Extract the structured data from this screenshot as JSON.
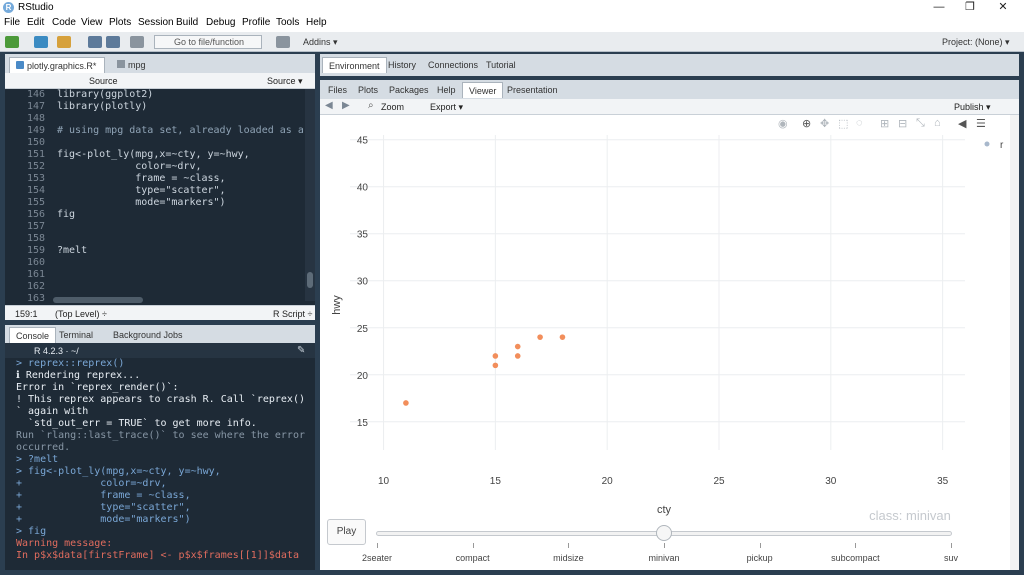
{
  "window": {
    "title": "RStudio",
    "minimize": "—",
    "restore": "❐",
    "close": "✕"
  },
  "menu": [
    "File",
    "Edit",
    "Code",
    "View",
    "Plots",
    "Session",
    "Build",
    "Debug",
    "Profile",
    "Tools",
    "Help"
  ],
  "toolbar": {
    "goto_placeholder": "Go to file/function",
    "addins": "Addins ▾",
    "project": "Project: (None) ▾"
  },
  "editor": {
    "tabs": [
      {
        "label": "plotly.graphics.R*"
      },
      {
        "label": "mpg"
      }
    ],
    "source_label": "Source",
    "source_menu": "Source ▾",
    "lines": [
      {
        "n": "146",
        "text": "library(ggplot2)",
        "style": "code"
      },
      {
        "n": "147",
        "text": "library(plotly)",
        "style": "code"
      },
      {
        "n": "148",
        "text": "",
        "style": "code"
      },
      {
        "n": "149",
        "text": "# using mpg data set, already loaded as a",
        "style": "comment"
      },
      {
        "n": "150",
        "text": "",
        "style": "code"
      },
      {
        "n": "151",
        "text": "fig<-plot_ly(mpg,x=~cty, y=~hwy,",
        "style": "code"
      },
      {
        "n": "152",
        "text": "             color=~drv,",
        "style": "code"
      },
      {
        "n": "153",
        "text": "             frame = ~class,",
        "style": "code"
      },
      {
        "n": "154",
        "text": "             type=\"scatter\",",
        "style": "code"
      },
      {
        "n": "155",
        "text": "             mode=\"markers\")",
        "style": "code"
      },
      {
        "n": "156",
        "text": "fig",
        "style": "code"
      },
      {
        "n": "157",
        "text": "",
        "style": "code"
      },
      {
        "n": "158",
        "text": "",
        "style": "code"
      },
      {
        "n": "159",
        "text": "?melt",
        "style": "code"
      },
      {
        "n": "160",
        "text": "",
        "style": "code"
      },
      {
        "n": "161",
        "text": "",
        "style": "code"
      },
      {
        "n": "162",
        "text": "",
        "style": "code"
      },
      {
        "n": "163",
        "text": "",
        "style": "code"
      }
    ],
    "status_pos": "159:1",
    "status_scope": "(Top Level) ÷",
    "status_type": "R Script ÷"
  },
  "console": {
    "tabs": [
      {
        "label": "Console"
      },
      {
        "label": "Terminal"
      },
      {
        "label": "Background Jobs"
      }
    ],
    "version": "R 4.2.3 · ~/",
    "lines": [
      {
        "text": "> reprex::reprex()",
        "style": "prompt"
      },
      {
        "text": "ℹ Rendering reprex...",
        "style": "white"
      },
      {
        "text": "Error in `reprex_render()`:",
        "style": "white"
      },
      {
        "text": "! This reprex appears to crash R. Call `reprex()",
        "style": "white"
      },
      {
        "text": "` again with",
        "style": "white"
      },
      {
        "text": "  `std_out_err = TRUE` to get more info.",
        "style": "white"
      },
      {
        "text": "Run `rlang::last_trace()` to see where the error",
        "style": "dim"
      },
      {
        "text": "occurred.",
        "style": "dim"
      },
      {
        "text": "> ?melt",
        "style": "prompt"
      },
      {
        "text": "> fig<-plot_ly(mpg,x=~cty, y=~hwy,",
        "style": "prompt"
      },
      {
        "text": "+             color=~drv,",
        "style": "prompt"
      },
      {
        "text": "+             frame = ~class,",
        "style": "prompt"
      },
      {
        "text": "+             type=\"scatter\",",
        "style": "prompt"
      },
      {
        "text": "+             mode=\"markers\")",
        "style": "prompt"
      },
      {
        "text": "> fig",
        "style": "prompt"
      },
      {
        "text": "Warning message:",
        "style": "err"
      },
      {
        "text": "In p$x$data[firstFrame] <- p$x$frames[[1]]$data",
        "style": "err"
      }
    ]
  },
  "env_panel": {
    "tabs": [
      {
        "label": "Environment"
      },
      {
        "label": "History"
      },
      {
        "label": "Connections"
      },
      {
        "label": "Tutorial"
      }
    ]
  },
  "viewer_panel": {
    "tabs": [
      {
        "label": "Files"
      },
      {
        "label": "Plots"
      },
      {
        "label": "Packages"
      },
      {
        "label": "Help"
      },
      {
        "label": "Viewer"
      },
      {
        "label": "Presentation"
      }
    ],
    "zoom": "Zoom",
    "export": "Export ▾",
    "publish": "Publish ▾"
  },
  "chart_data": {
    "type": "scatter",
    "xlabel": "cty",
    "ylabel": "hwy",
    "xlim": [
      8.5,
      36
    ],
    "ylim": [
      12,
      45.5
    ],
    "xticks": [
      10,
      15,
      20,
      25,
      30,
      35
    ],
    "yticks": [
      15,
      20,
      25,
      30,
      35,
      40,
      45
    ],
    "grid": true,
    "legend_position": "top-right",
    "series": [
      {
        "name": "r",
        "color": "#f28e5b",
        "points": [
          [
            11,
            17
          ],
          [
            15,
            21
          ],
          [
            15,
            22
          ],
          [
            16,
            22
          ],
          [
            16,
            23
          ],
          [
            17,
            24
          ],
          [
            18,
            24
          ]
        ]
      }
    ],
    "frame_label": "class: minivan",
    "frames": [
      "2seater",
      "compact",
      "midsize",
      "minivan",
      "pickup",
      "subcompact",
      "suv"
    ],
    "current_frame": "minivan",
    "play_label": "Play"
  }
}
